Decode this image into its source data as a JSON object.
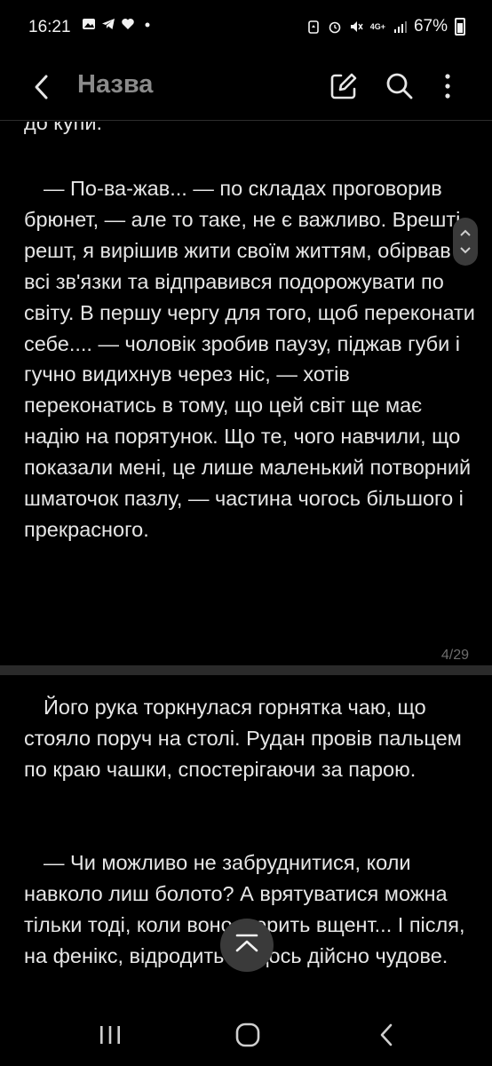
{
  "status": {
    "time": "16:21",
    "network": "4G+",
    "battery": "67%"
  },
  "header": {
    "title": "Назва"
  },
  "page": {
    "top_fragment": "до купи.",
    "paragraph1": "— По-ва-жав... — по складах проговорив брюнет, — але то таке, не є важливо. Врешті решт, я вирішив жити своїм життям, обірвав всі зв'язки та відправився подорожувати по світу. В першу чергу для того, щоб переконати себе.... — чоловік зробив паузу, піджав губи і гучно видихнув через ніс, — хотів переконатись в тому, що цей світ ще має надію на порятунок. Що те, чого навчили, що показали мені, це лише маленький потворний шматочок пазлу, — частина чогось більшого і прекрасного.",
    "page_number": "4/29",
    "paragraph2": "Його рука торкнулася горнятка чаю, що стояло поруч на столі. Рудан провів пальцем по краю чашки, спостерігаючи за парою.",
    "paragraph3": "— Чи можливо не забруднитися, коли навколо лиш болото? А врятуватися можна тільки тоді, коли воно згорить вщент... І після, на фенікс, відродиться щось дійсно чудове."
  },
  "icons": {
    "back": "chevron-left-icon",
    "edit": "edit-icon",
    "search": "search-icon",
    "more": "more-vertical-icon",
    "scroll_top": "scroll-to-top-icon",
    "nav_recents": "recents-icon",
    "nav_home": "home-icon",
    "nav_back": "back-icon"
  },
  "colors": {
    "background": "#000000",
    "text": "#e6e6e6",
    "title": "#8a8a8a",
    "divider": "#2a2a2a"
  }
}
